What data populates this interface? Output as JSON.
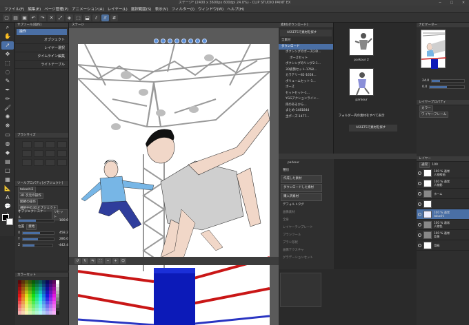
{
  "window": {
    "title": "ステージ* (2400 x 3600px 600dpi 24.0%) - CLIP STUDIO PAINT EX"
  },
  "menu": [
    "ファイル(F)",
    "編集(E)",
    "ページ管理(P)",
    "アニメーション(A)",
    "レイヤー(L)",
    "選択範囲(S)",
    "表示(V)",
    "フィルター(I)",
    "ウィンドウ(W)",
    "ヘルプ(H)"
  ],
  "subtool": {
    "title": "サブツール[操作]",
    "items": [
      "操作",
      "オブジェクト",
      "レイヤー選択",
      "タイムライン編集",
      "ライトテーブル"
    ],
    "selected_index": 0
  },
  "brush_panel": {
    "title": "ブラシサイズ"
  },
  "tool_property": {
    "title": "ツールプロパティ[オブジェクト]",
    "object_name": "takashi1",
    "rows": [
      "3D 次元の操作",
      "関節の操作",
      "選択中の3Dオブジェクト"
    ],
    "scale_label": "オブジェクトスケール",
    "reset_label": "リセット",
    "scale_value": "100.0",
    "position_label": "位置",
    "reset2_label": "接地",
    "x_label": "X",
    "x_value": "458.2",
    "y_label": "Y",
    "y_value": "286.0",
    "z_label": "Z",
    "z_value": "-442.4"
  },
  "color_panel": {
    "title": "カラーセット"
  },
  "canvas": {
    "tab_label": "ステージ",
    "zoom": "24.0"
  },
  "materials": {
    "title": "素材[ダウンロード]",
    "assets_button": "ASSETSで素材を探す",
    "tree": [
      "全素材",
      "ダウンロード",
      "ボクシングのポーズ(3D…",
      "ポーズセット",
      "ボクシングのリング2-1…",
      "3D姿勢セット-1768…",
      "カラテリー82-1658…",
      "ボリュームセット-1…",
      "ポーズ",
      "セットセット-1…",
      "YGGアクションライン…",
      "肉のあるから…",
      "まとめ-1481844",
      "主ポーズ-1477…"
    ],
    "selected_index": 1,
    "thumbs": [
      "parkour 2",
      "parkour"
    ],
    "show_all_label": "フォルダー内の素材をすべて表示",
    "assets_button2": "ASSETSで素材を探す",
    "parkour_label": "parkour",
    "props_header": "種別",
    "props": [
      "作成した素材",
      "ダウンロードした素材",
      "購入済素材"
    ],
    "props_header2": "デフォルトタグ",
    "props_dim": [
      "画像素材",
      "全身",
      "レイヤーテンプレート",
      "ブラシツール",
      "ブラシ形状",
      "画像テクスチャ",
      "グラデーションセット"
    ]
  },
  "navigator": {
    "title": "ナビゲーター",
    "zoom": "24.0",
    "angle": "0.0"
  },
  "layer_property": {
    "title": "レイヤープロパティ",
    "effect": "カラー",
    "group": "ワイヤーフレーム"
  },
  "layers": {
    "title": "レイヤー",
    "blend": "通常",
    "opacity": "100",
    "rows": [
      {
        "name": "100 % 通常\n人物線画"
      },
      {
        "name": "100 % 通常\n人物影"
      },
      {
        "name": "ホーム"
      },
      {
        "name": ""
      },
      {
        "name": "100 % 通常\ntakashi"
      },
      {
        "name": "100 % 通常\n人物色"
      },
      {
        "name": "100 % 通常\n背景"
      },
      {
        "name": "用紙"
      }
    ],
    "selected_index": 4
  },
  "colors": {
    "accent": "#4a6fa5",
    "main_color": "#000000",
    "sub_color": "#ffffff"
  }
}
